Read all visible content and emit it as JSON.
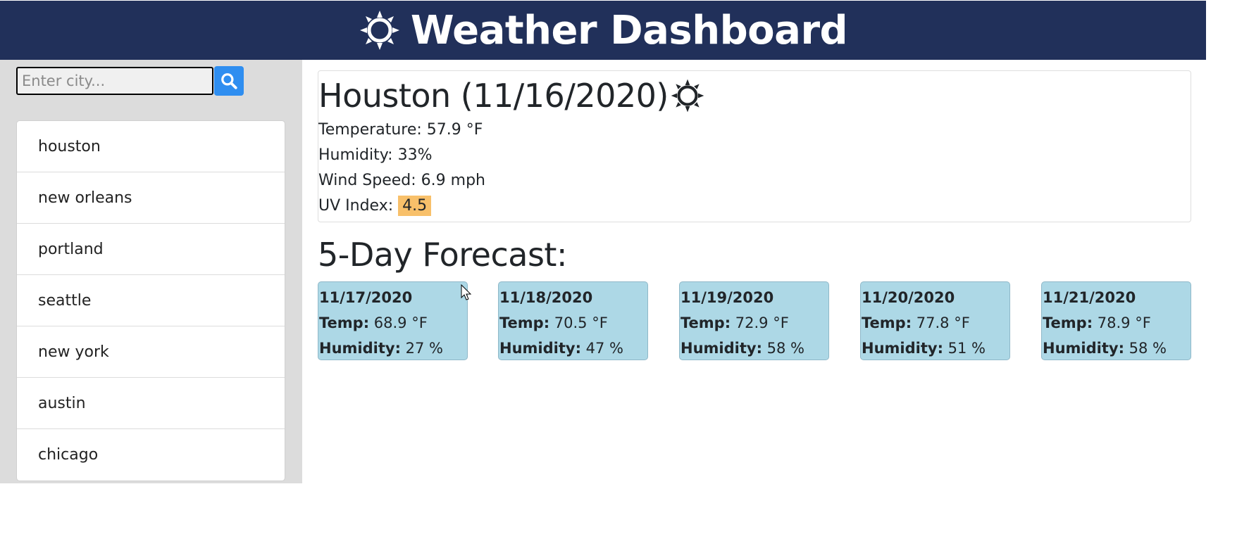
{
  "header": {
    "icon": "sun-icon",
    "title": "Weather Dashboard"
  },
  "search": {
    "placeholder": "Enter city...",
    "value": "",
    "button_icon": "search-icon"
  },
  "cities": [
    "houston",
    "new orleans",
    "portland",
    "seattle",
    "new york",
    "austin",
    "chicago"
  ],
  "current": {
    "title": "Houston (11/16/2020)",
    "icon": "sun-icon",
    "temperature_label": "Temperature:",
    "temperature_value": "57.9 °F",
    "humidity_label": "Humidity:",
    "humidity_value": "33%",
    "wind_label": "Wind Speed:",
    "wind_value": "6.9 mph",
    "uv_label": "UV Index:",
    "uv_value": "4.5"
  },
  "forecast": {
    "title": "5-Day Forecast:",
    "temp_label": "Temp:",
    "humidity_label": "Humidity:",
    "days": [
      {
        "date": "11/17/2020",
        "temp": "68.9 °F",
        "humidity": "27 %"
      },
      {
        "date": "11/18/2020",
        "temp": "70.5 °F",
        "humidity": "47 %"
      },
      {
        "date": "11/19/2020",
        "temp": "72.9 °F",
        "humidity": "58 %"
      },
      {
        "date": "11/20/2020",
        "temp": "77.8 °F",
        "humidity": "51 %"
      },
      {
        "date": "11/21/2020",
        "temp": "78.9 °F",
        "humidity": "58 %"
      }
    ]
  },
  "colors": {
    "header_bg": "#21305a",
    "sidebar_bg": "#dcdcdc",
    "search_button": "#2f8ef0",
    "card_bg": "#add8e6",
    "uv_badge": "#f8c06a"
  }
}
